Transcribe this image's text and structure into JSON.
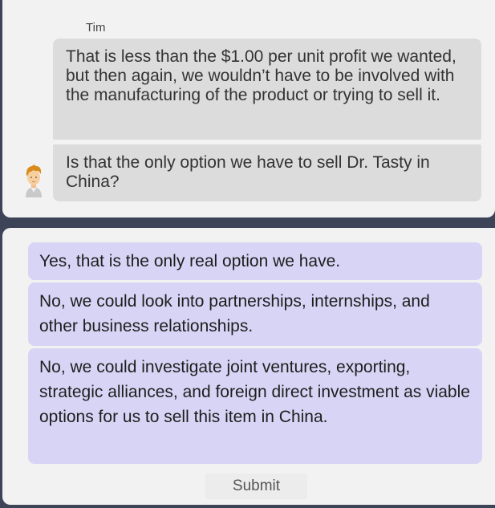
{
  "conversation": {
    "speaker": "Tim",
    "messages": [
      "That is less than the $1.00 per unit profit we wanted, but then again, we wouldn’t have to be involved with the manufacturing of the product or trying to sell it.",
      "Is that the only option we have to sell Dr. Tasty in China?"
    ],
    "avatar_icon": "cartoon-man-avatar"
  },
  "responses": {
    "options": [
      "Yes, that is the only real option we have.",
      "No, we could look into partnerships, internships, and other business relationships.",
      "No, we could investigate joint ventures, exporting, strategic alliances, and foreign direct investment as viable options for us to sell this item in China."
    ],
    "submit_label": "Submit"
  },
  "colors": {
    "background": "#3d4457",
    "panel": "#f2f2f2",
    "message_bubble": "#dcdcdc",
    "option_bubble": "#d8d4f5"
  }
}
